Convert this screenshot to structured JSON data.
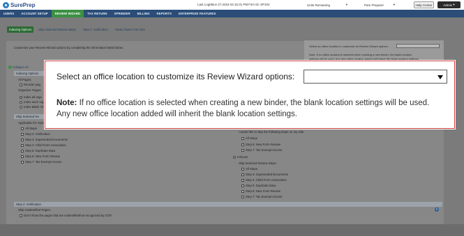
{
  "header": {
    "logo": "SurePrep",
    "last_login": "Last Login:",
    "last_login_value": "Nov 27,2018 04:15:31 PM",
    "firm_id_label": "Firm ID:",
    "firm_id_value": "SP102",
    "units": "Units Remaining",
    "user": "Pam Preparer",
    "help": "Help Center",
    "admin": "Admin"
  },
  "nav": {
    "items": [
      "USERS",
      "ACCOUNT SETUP",
      "REVIEW WIZARD",
      "TAX RETURN",
      "SPRINDER",
      "BILLING",
      "REPORTS",
      "ENTERPRISE FEATURES"
    ],
    "active_index": 2
  },
  "subtabs": {
    "items": [
      "Indexing Options",
      "Skip Selected Review Steps",
      "Step 2: Verification",
      "Sticky Notes Font Size"
    ],
    "active_index": 0
  },
  "intro": "Customize your Review Wizard options by completing the information listed below.",
  "bg_office": {
    "prompt": "Select an office location to customize its Review Wizard options:",
    "note_line1": "Note: If no office location is selected when creating a new binder, the blank location",
    "note_line2": "settings will be used. Any new office location added will inherit the blank location settings."
  },
  "collapse_all": "Collapse All",
  "indexing": {
    "header": "Indexing Options",
    "all_pages": "All Pages:",
    "reorder": "Reorder pag",
    "organizer_pages": "Organizer Pages:",
    "opt1": "Index all orga",
    "opt2": "Index each org",
    "opt3": "Index Blank Or"
  },
  "skip": {
    "header": "Skip Selected Re",
    "applicable": "Applicable for: Kyle",
    "left": [
      "All Steps",
      "Step 2: Verification",
      "Step 3: Superseded Documents",
      "Step 4: Child Form Association",
      "Step 5: Duplicate Data",
      "Step 6: New Form Review",
      "Step 7: Tax Exempt Income"
    ],
    "right_intro": "I would like to skip the following steps on my side",
    "right_top": [
      "All Steps",
      "Step 6: New Form Review",
      "Step 7: Tax Exempt Income"
    ],
    "inhouse": "Inhouse",
    "skip_selected": "Skip Selected Review Steps",
    "right_bottom": [
      "All Steps",
      "Step 3: Superseded Documents",
      "Step 4: Child Form Association",
      "Step 5: Duplicate Data",
      "Step 6: New Form Review",
      "Step 7: Tax Exempt Income"
    ]
  },
  "verification": {
    "header": "Step 2: Verification",
    "skip_label": "Skip Unidentified Pages:",
    "option": "Don't show the pages that are unidentified/not recognized by OCR"
  },
  "callout": {
    "prompt": "Select an office location to customize its Review Wizard options:",
    "note_label": "Note:",
    "note_text": " If no office location is selected when creating a new binder, the blank location settings will be used. Any new office location added will inherit the blank location settings."
  },
  "icons": {
    "caret": "chevron-down-icon",
    "help": "help-icon",
    "collapse": "collapse-icon"
  }
}
